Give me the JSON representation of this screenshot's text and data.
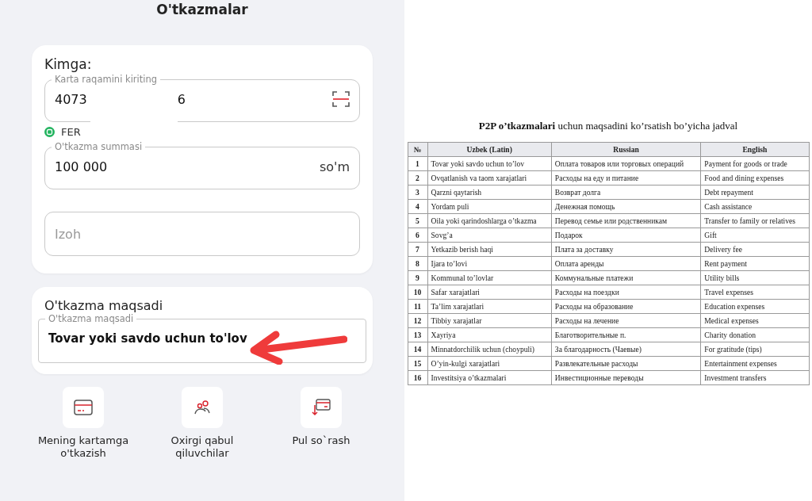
{
  "header": {
    "title": "O'tkazmalar"
  },
  "recipient_card": {
    "title": "Kimga:",
    "card_field": {
      "label": "Karta raqamini kiriting",
      "value_start": "4073",
      "value_end": "6"
    },
    "recipient": {
      "name": "FER"
    },
    "amount_field": {
      "label": "O'tkazma summasi",
      "value": "100 000",
      "currency": "so'm"
    },
    "comment_field": {
      "placeholder": "Izoh"
    }
  },
  "purpose_card": {
    "title": "O'tkazma maqsadi",
    "field": {
      "label": "O'tkazma maqsadi",
      "value": "Tovar yoki savdo uchun to'lov"
    }
  },
  "shortcuts": [
    {
      "label": "Mening kartamga o'tkazish",
      "kind": "card"
    },
    {
      "label": "Oxirgi qabul qiluvchilar",
      "kind": "people"
    },
    {
      "label": "Pul so`rash",
      "kind": "request"
    }
  ],
  "table": {
    "title": "**P2P o’tkazmalari** uchun maqsadini ko’rsatish bo’yicha jadval",
    "columns": [
      "№",
      "Uzbek (Latin)",
      "Russian",
      "English"
    ],
    "rows": [
      [
        "1",
        "Tovar yoki savdo uchun to’lov",
        "Оплата товаров или торговых операций",
        "Payment for goods or trade"
      ],
      [
        "2",
        "Ovqatlanish va taom xarajatlari",
        "Расходы на еду и питание",
        "Food and dining expenses"
      ],
      [
        "3",
        "Qarzni qaytarish",
        "Возврат долга",
        "Debt repayment"
      ],
      [
        "4",
        "Yordam puli",
        "Денежная помощь",
        "Cash assistance"
      ],
      [
        "5",
        "Oila yoki qarindoshlarga o’tkazma",
        "Перевод семье или родственникам",
        "Transfer to family or relatives"
      ],
      [
        "6",
        "Sovg’a",
        "Подарок",
        "Gift"
      ],
      [
        "7",
        "Yetkazib berish haqi",
        "Плата за доставку",
        "Delivery fee"
      ],
      [
        "8",
        "Ijara to’lovi",
        "Оплата аренды",
        "Rent payment"
      ],
      [
        "9",
        "Kommunal to’lovlar",
        "Коммунальные платежи",
        "Utility bills"
      ],
      [
        "10",
        "Safar xarajatlari",
        "Расходы на поездки",
        "Travel expenses"
      ],
      [
        "11",
        "Ta’lim xarajatlari",
        "Расходы на образование",
        "Education expenses"
      ],
      [
        "12",
        "Tibbiy xarajatlar",
        "Расходы на лечение",
        "Medical expenses"
      ],
      [
        "13",
        "Xayriya",
        "Благотворительные п.",
        "Charity donation"
      ],
      [
        "14",
        "Minnatdorchilik uchun (choypuli)",
        "За благодарность (Чаевые)",
        "For gratitude (tips)"
      ],
      [
        "15",
        "O’yin-kulgi xarajatlari",
        "Развлекательные расходы",
        "Entertainment expenses"
      ],
      [
        "16",
        "Investitsiya o’tkazmalari",
        "Инвестиционные переводы",
        "Investment transfers"
      ]
    ]
  }
}
